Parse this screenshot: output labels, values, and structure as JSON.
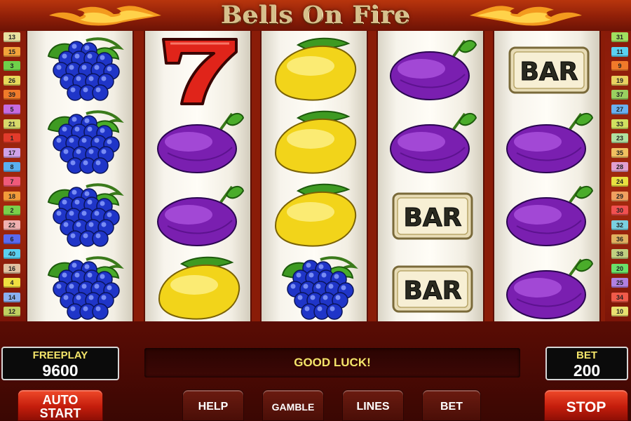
{
  "title": "Bells On Fire",
  "left_lines": [
    "13",
    "15",
    "3",
    "26",
    "39",
    "5",
    "21",
    "1",
    "17",
    "8",
    "7",
    "18",
    "2",
    "22",
    "6",
    "40",
    "16",
    "4",
    "14",
    "12"
  ],
  "right_lines": [
    "31",
    "11",
    "9",
    "19",
    "37",
    "27",
    "33",
    "23",
    "35",
    "28",
    "24",
    "29",
    "30",
    "32",
    "36",
    "38",
    "20",
    "25",
    "34",
    "10"
  ],
  "line_colors": {
    "13": "#e8e0a0",
    "15": "#f2a23a",
    "3": "#6fd04a",
    "26": "#e6d95a",
    "39": "#f07a2a",
    "5": "#c66be0",
    "21": "#d8d86a",
    "1": "#e23b2b",
    "17": "#cfa2e8",
    "8": "#5ab0f0",
    "7": "#ef5a7a",
    "18": "#f29a3a",
    "2": "#7ad04a",
    "22": "#f0b0b0",
    "6": "#5a6af0",
    "40": "#5ad0f0",
    "16": "#e0c0a0",
    "4": "#f0e040",
    "14": "#8ab0f0",
    "12": "#c0d060",
    "31": "#a0e060",
    "11": "#5ad0f0",
    "9": "#f07a2a",
    "19": "#e8d060",
    "37": "#9ad060",
    "27": "#6ab0f0",
    "33": "#d0e060",
    "23": "#b0e0a0",
    "35": "#f0c060",
    "28": "#e0a0d0",
    "24": "#e8e040",
    "29": "#f0a060",
    "30": "#f05050",
    "32": "#7ad0e0",
    "36": "#e0b060",
    "38": "#c0d080",
    "20": "#6ae06a",
    "25": "#b080e0",
    "34": "#f05a4a",
    "10": "#e8e070"
  },
  "reels": [
    [
      "grapes",
      "grapes",
      "grapes",
      "grapes"
    ],
    [
      "seven",
      "plum",
      "plum",
      "lemon"
    ],
    [
      "lemon",
      "lemon",
      "lemon",
      "grapes"
    ],
    [
      "plum",
      "plum",
      "bar",
      "bar"
    ],
    [
      "bar",
      "plum",
      "plum",
      "plum"
    ]
  ],
  "symbol_label": "BAR",
  "freeplay": {
    "label": "FREEPLAY",
    "value": "9600"
  },
  "message": "GOOD LUCK!",
  "bet": {
    "label": "BET",
    "value": "200"
  },
  "buttons": {
    "autostart_1": "AUTO",
    "autostart_2": "START",
    "help": "HELP",
    "gamble": "GAMBLE",
    "lines": "LINES",
    "bet": "BET",
    "stop": "STOP"
  }
}
